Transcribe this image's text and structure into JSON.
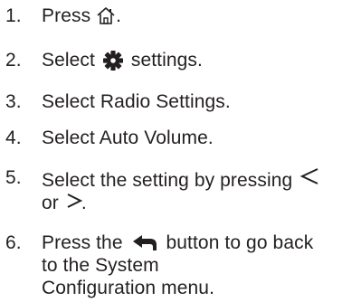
{
  "steps": [
    {
      "number": "1.",
      "text_before": "Press",
      "icon": "home-icon",
      "text_after": "."
    },
    {
      "number": "2.",
      "text_before": "Select",
      "icon": "gear-icon",
      "text_after": "settings."
    },
    {
      "number": "3.",
      "text": "Select Radio Settings."
    },
    {
      "number": "4.",
      "text": "Select Auto Volume."
    },
    {
      "number": "5.",
      "text_before": "Select the setting by pressing",
      "icon_left": "chevron-left-icon",
      "text_middle": "or",
      "icon_right": "chevron-right-icon",
      "text_after": "."
    },
    {
      "number": "6.",
      "text_before": "Press the",
      "icon": "back-arrow-icon",
      "line1_after": "button to go back",
      "line2": "to the System",
      "line3": "Configuration menu."
    }
  ],
  "colors": {
    "text": "#231f20",
    "icon": "#231f20"
  }
}
